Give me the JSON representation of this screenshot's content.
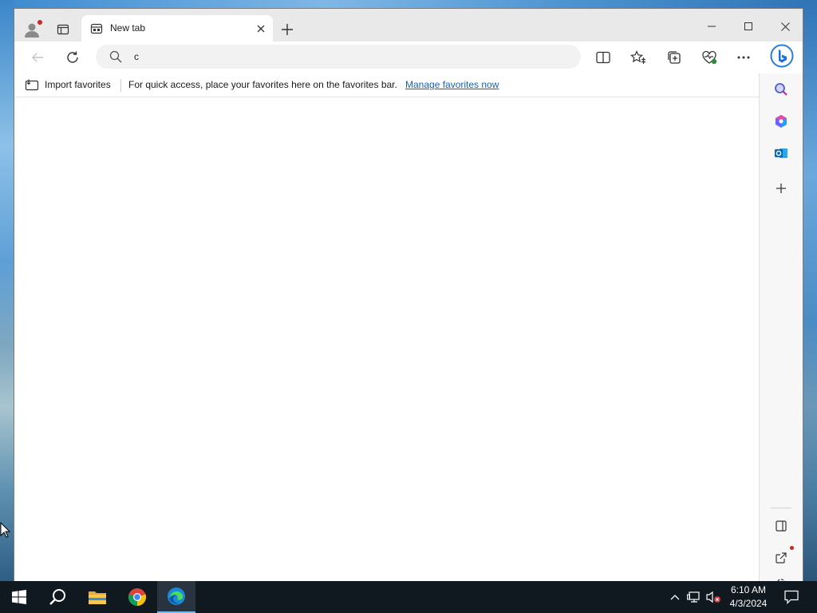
{
  "browser": {
    "tab": {
      "title": "New tab",
      "icon": "new-tab-page-icon"
    },
    "address_bar": {
      "value": "c",
      "icon": "search-icon"
    },
    "favorites_bar": {
      "import_label": "Import favorites",
      "message": "For quick access, place your favorites here on the favorites bar.",
      "manage_link": "Manage favorites now"
    },
    "toolbar_icons": [
      "back-icon",
      "refresh-icon",
      "split-screen-icon",
      "favorites-icon",
      "collections-icon",
      "browser-essentials-icon",
      "more-icon",
      "bing-copilot-icon"
    ],
    "sidebar_icons": [
      "search-icon",
      "office-icon",
      "outlook-icon",
      "add-icon",
      "hide-sidebar-icon",
      "external-link-icon",
      "settings-icon"
    ]
  },
  "taskbar": {
    "apps": [
      "start-icon",
      "search-icon",
      "file-explorer-icon",
      "chrome-icon",
      "edge-icon"
    ],
    "clock": {
      "time": "6:10 AM",
      "date": "4/3/2024"
    }
  },
  "colors": {
    "link": "#1a5fb4",
    "taskbar": "#101820",
    "accent": "#76b9ed",
    "notification_dot": "#c42b1c"
  }
}
